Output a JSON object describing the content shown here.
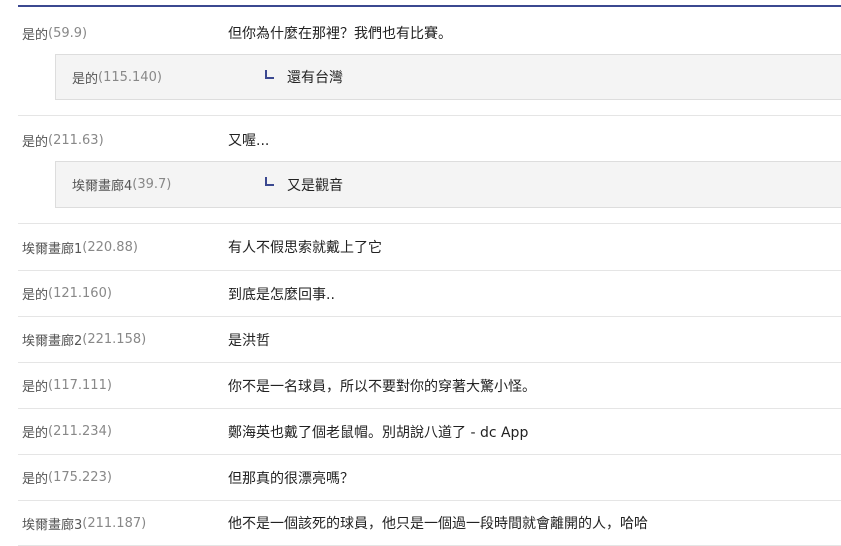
{
  "comments": [
    {
      "nick": "是的",
      "ip": "(59.9)",
      "text": "但你為什麼在那裡？我們也有比賽。"
    },
    {
      "reply_nick": "是的",
      "reply_ip": "(115.140)",
      "reply_text": "還有台灣"
    },
    {
      "nick": "是的",
      "ip": "(211.63)",
      "text": "又喔..."
    },
    {
      "reply_nick": "埃爾畫廊4",
      "reply_ip": "(39.7)",
      "reply_text": "又是觀音"
    },
    {
      "nick": "埃爾畫廊1",
      "ip": "(220.88)",
      "text": "有人不假思索就戴上了它"
    },
    {
      "nick": "是的",
      "ip": "(121.160)",
      "text": "到底是怎麼回事.."
    },
    {
      "nick": "埃爾畫廊2",
      "ip": "(221.158)",
      "text": "是洪哲"
    },
    {
      "nick": "是的",
      "ip": "(117.111)",
      "text": "你不是一名球員，所以不要對你的穿著大驚小怪。"
    },
    {
      "nick": "是的",
      "ip": "(211.234)",
      "text": "鄭海英也戴了個老鼠帽。別胡說八道了 - dc App"
    },
    {
      "nick": "是的",
      "ip": "(175.223)",
      "text": "但那真的很漂亮嗎？"
    },
    {
      "nick": "埃爾畫廊3",
      "ip": "(211.187)",
      "text": "他不是一個該死的球員，他只是一個過一段時間就會離開的人，哈哈"
    }
  ],
  "colors": {
    "accent": "#3b4890",
    "reply_bg": "#f4f4f4"
  }
}
